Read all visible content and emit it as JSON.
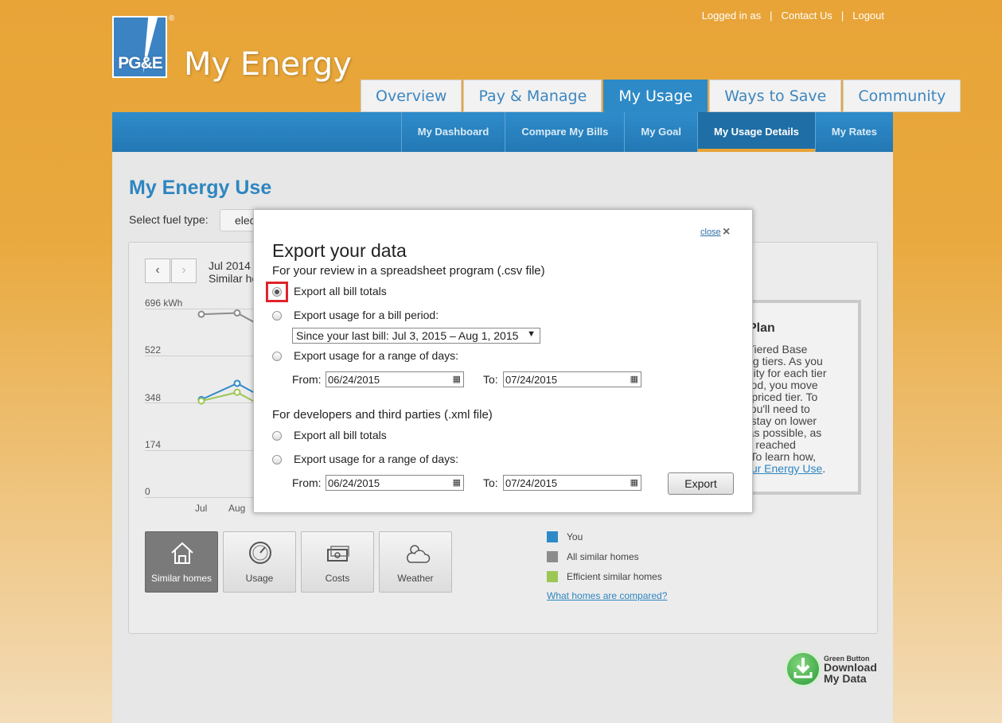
{
  "header": {
    "logo_text": "PG&E",
    "logo_reg": "®",
    "app_title": "My Energy",
    "links": [
      "Logged in as",
      "Contact Us",
      "Logout"
    ]
  },
  "main_tabs": [
    {
      "label": "Overview",
      "active": false
    },
    {
      "label": "Pay & Manage",
      "active": false
    },
    {
      "label": "My Usage",
      "active": true
    },
    {
      "label": "Ways to Save",
      "active": false
    },
    {
      "label": "Community",
      "active": false
    }
  ],
  "sub_nav": [
    {
      "label": "My Dashboard",
      "active": false
    },
    {
      "label": "Compare My Bills",
      "active": false
    },
    {
      "label": "My Goal",
      "active": false
    },
    {
      "label": "My Usage Details",
      "active": true
    },
    {
      "label": "My Rates",
      "active": false
    }
  ],
  "page": {
    "title": "My Energy Use",
    "fuel_label": "Select fuel type:",
    "fuel_value": "elec",
    "period_line1": "Jul 2014",
    "period_line2": "Similar ho"
  },
  "chart": {
    "y_ticks": [
      "696 kWh",
      "522",
      "348",
      "174",
      "0"
    ],
    "x_ticks": [
      "Jul",
      "Aug"
    ]
  },
  "chart_data": {
    "type": "line",
    "x": [
      "Jul",
      "Aug"
    ],
    "series": [
      {
        "name": "You",
        "values": [
          360,
          420
        ]
      },
      {
        "name": "All similar homes",
        "values": [
          675,
          680
        ]
      },
      {
        "name": "Efficient similar homes",
        "values": [
          355,
          387
        ]
      }
    ],
    "ylim": [
      0,
      696
    ],
    "ylabel": "kWh"
  },
  "rate_panel": {
    "title": "Plan",
    "text": "d Tiered Base\ncing tiers. As you\ntricity for each tier\neriod, you move\ner priced tier. To\n, you'll need to\n to stay on lower\ng as possible, as\n've reached\ns. To learn how,",
    "link": "Your Energy Use",
    "link_suffix": "."
  },
  "view_buttons": [
    {
      "label": "Similar homes",
      "icon": "house-icon",
      "active": true
    },
    {
      "label": "Usage",
      "icon": "gauge-icon",
      "active": false
    },
    {
      "label": "Costs",
      "icon": "money-icon",
      "active": false
    },
    {
      "label": "Weather",
      "icon": "weather-icon",
      "active": false
    }
  ],
  "legend": [
    {
      "label": "You",
      "color": "#2e8ac7"
    },
    {
      "label": "All similar homes",
      "color": "#8c8c8c"
    },
    {
      "label": "Efficient similar homes",
      "color": "#9cc755"
    }
  ],
  "legend_link": "What homes are compared?",
  "green_button": {
    "small": "Green Button",
    "line1": "Download",
    "line2": "My Data"
  },
  "modal": {
    "close_label": "close",
    "close_icon": "×",
    "title": "Export your data",
    "csv_heading": "For your review in a spreadsheet program (.csv file)",
    "csv_opt1": "Export all bill totals",
    "csv_opt2": "Export usage for a bill period:",
    "bill_period_value": "Since your last bill: Jul 3, 2015 – Aug 1, 2015",
    "csv_opt3": "Export usage for a range of days:",
    "from_label": "From:",
    "to_label": "To:",
    "csv_from": "06/24/2015",
    "csv_to": "07/24/2015",
    "xml_heading": "For developers and third parties (.xml file)",
    "xml_opt1": "Export all bill totals",
    "xml_opt2": "Export usage for a range of days:",
    "xml_from": "06/24/2015",
    "xml_to": "07/24/2015",
    "export_label": "Export"
  }
}
